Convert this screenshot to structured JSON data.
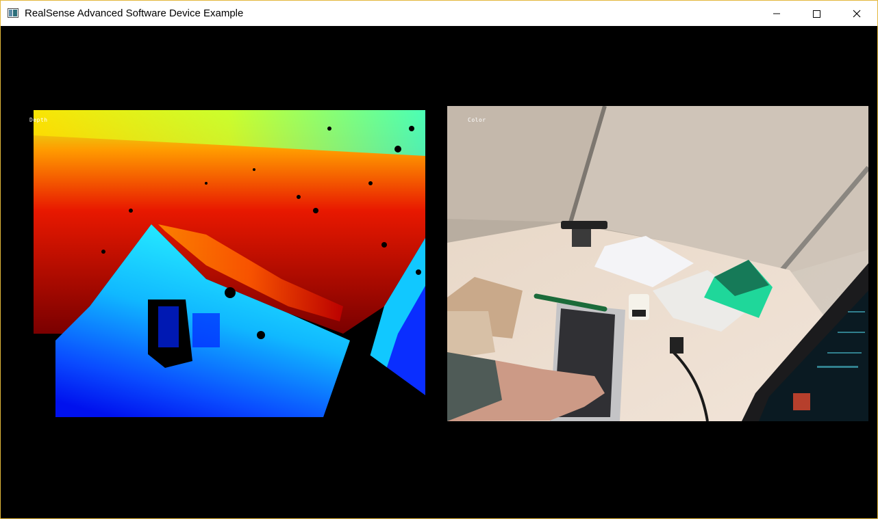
{
  "window": {
    "title": "RealSense Advanced Software Device Example",
    "icon": "app-window-icon",
    "controls": [
      "minimize-icon",
      "maximize-icon",
      "close-icon"
    ]
  },
  "streams": {
    "depth": {
      "label": "Depth",
      "colormap": "jet"
    },
    "color": {
      "label": "Color"
    }
  },
  "colors": {
    "titlebar_bg": "#ffffff",
    "window_border": "#e3b73a",
    "viewport_bg": "#000000"
  }
}
